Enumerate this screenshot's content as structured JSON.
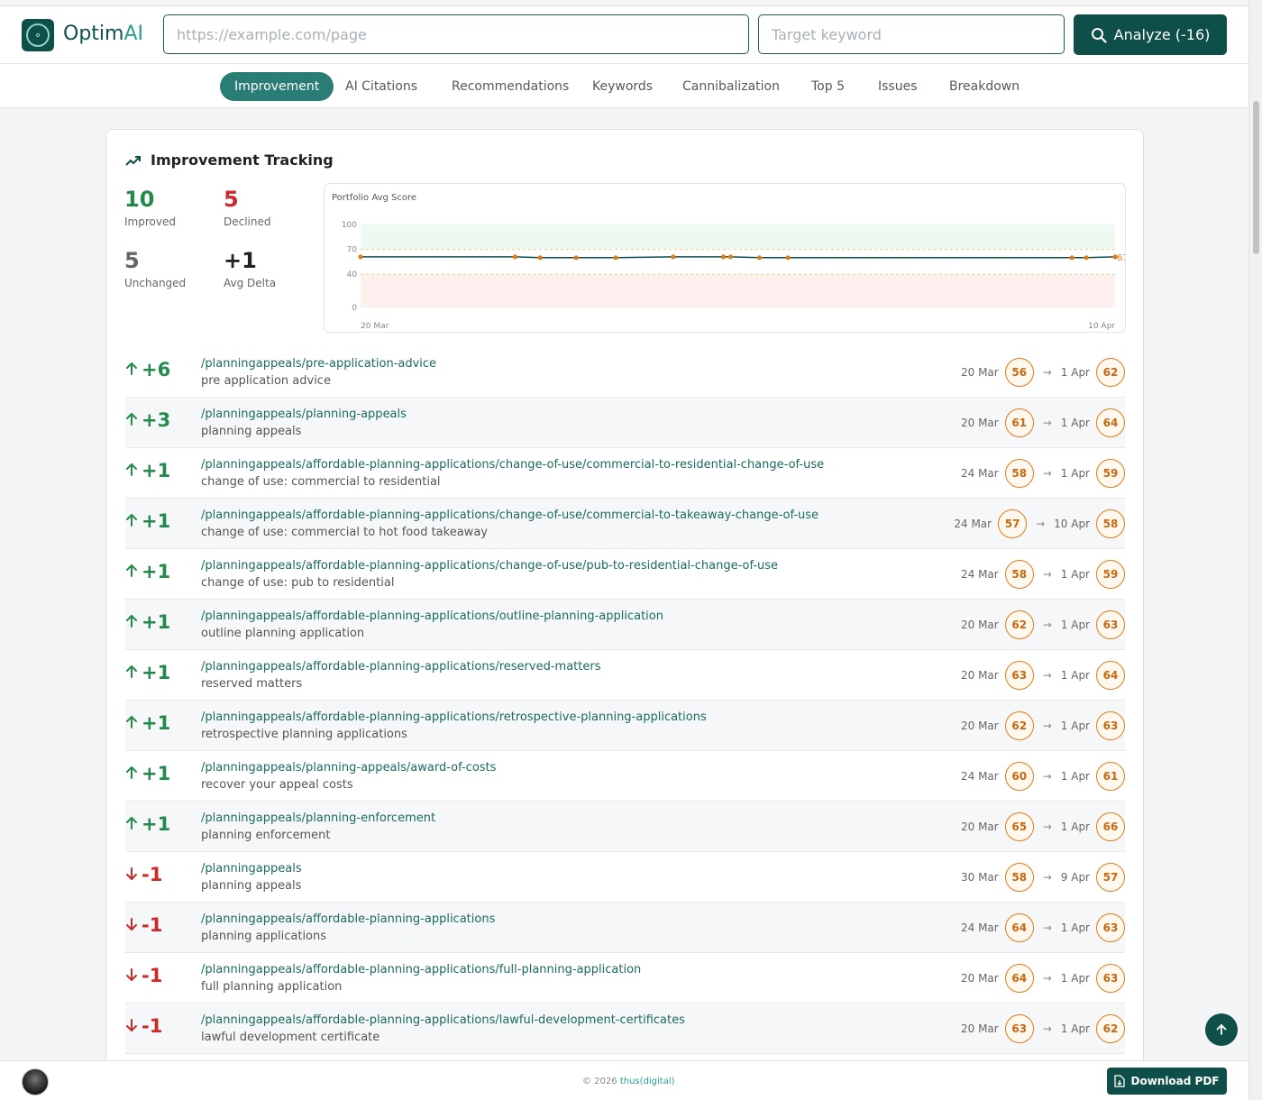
{
  "header": {
    "brand_prefix": "Optim",
    "brand_suffix": "AI",
    "url_placeholder": "https://example.com/page",
    "keyword_placeholder": "Target keyword",
    "analyze_label": "Analyze (-16)"
  },
  "tabs": [
    "Improvement",
    "AI Citations",
    "Recommendations",
    "Keywords",
    "Cannibalization",
    "Top 5",
    "Issues",
    "Breakdown"
  ],
  "active_tab": "Improvement",
  "card": {
    "title": "Improvement Tracking",
    "stats": {
      "improved": {
        "value": "10",
        "label": "Improved"
      },
      "declined": {
        "value": "5",
        "label": "Declined"
      },
      "unchanged": {
        "value": "5",
        "label": "Unchanged"
      },
      "avg_delta": {
        "value": "+1",
        "label": "Avg Delta"
      }
    }
  },
  "chart_data": {
    "type": "line",
    "title": "Portfolio Avg Score",
    "x_start_label": "20 Mar",
    "x_end_label": "10 Apr",
    "y_ticks": [
      "100",
      "70",
      "40",
      "0"
    ],
    "ylim": [
      0,
      100
    ],
    "bands": [
      {
        "from": 70,
        "to": 100,
        "color": "#eefaf1"
      },
      {
        "from": 40,
        "to": 70,
        "color": "#ffffff"
      },
      {
        "from": 0,
        "to": 40,
        "color": "#fdf0ef"
      }
    ],
    "thresholds": [
      70,
      40
    ],
    "x_range": [
      0,
      21
    ],
    "points": [
      {
        "x": 0,
        "y": 61
      },
      {
        "x": 4.3,
        "y": 61
      },
      {
        "x": 5,
        "y": 60
      },
      {
        "x": 6,
        "y": 60
      },
      {
        "x": 7.1,
        "y": 60
      },
      {
        "x": 8.7,
        "y": 61
      },
      {
        "x": 10.1,
        "y": 61
      },
      {
        "x": 10.3,
        "y": 61
      },
      {
        "x": 11.1,
        "y": 60
      },
      {
        "x": 11.9,
        "y": 60
      },
      {
        "x": 19.8,
        "y": 60
      },
      {
        "x": 20.2,
        "y": 60
      },
      {
        "x": 21,
        "y": 61
      }
    ],
    "last_label": "61",
    "line_color": "#0f4f4a",
    "point_color": "#e07b1a"
  },
  "rows": [
    {
      "delta": "+6",
      "dir": "up",
      "path": "/planningappeals/pre-application-advice",
      "keyword": "pre application advice",
      "from_date": "20 Mar",
      "from_score": "56",
      "to_date": "1 Apr",
      "to_score": "62"
    },
    {
      "delta": "+3",
      "dir": "up",
      "path": "/planningappeals/planning-appeals",
      "keyword": "planning appeals",
      "from_date": "20 Mar",
      "from_score": "61",
      "to_date": "1 Apr",
      "to_score": "64"
    },
    {
      "delta": "+1",
      "dir": "up",
      "path": "/planningappeals/affordable-planning-applications/change-of-use/commercial-to-residential-change-of-use",
      "keyword": "change of use: commercial to residential",
      "from_date": "24 Mar",
      "from_score": "58",
      "to_date": "1 Apr",
      "to_score": "59"
    },
    {
      "delta": "+1",
      "dir": "up",
      "path": "/planningappeals/affordable-planning-applications/change-of-use/commercial-to-takeaway-change-of-use",
      "keyword": "change of use: commercial to hot food takeaway",
      "from_date": "24 Mar",
      "from_score": "57",
      "to_date": "10 Apr",
      "to_score": "58"
    },
    {
      "delta": "+1",
      "dir": "up",
      "path": "/planningappeals/affordable-planning-applications/change-of-use/pub-to-residential-change-of-use",
      "keyword": "change of use: pub to residential",
      "from_date": "24 Mar",
      "from_score": "58",
      "to_date": "1 Apr",
      "to_score": "59"
    },
    {
      "delta": "+1",
      "dir": "up",
      "path": "/planningappeals/affordable-planning-applications/outline-planning-application",
      "keyword": "outline planning application",
      "from_date": "20 Mar",
      "from_score": "62",
      "to_date": "1 Apr",
      "to_score": "63"
    },
    {
      "delta": "+1",
      "dir": "up",
      "path": "/planningappeals/affordable-planning-applications/reserved-matters",
      "keyword": "reserved matters",
      "from_date": "20 Mar",
      "from_score": "63",
      "to_date": "1 Apr",
      "to_score": "64"
    },
    {
      "delta": "+1",
      "dir": "up",
      "path": "/planningappeals/affordable-planning-applications/retrospective-planning-applications",
      "keyword": "retrospective planning applications",
      "from_date": "20 Mar",
      "from_score": "62",
      "to_date": "1 Apr",
      "to_score": "63"
    },
    {
      "delta": "+1",
      "dir": "up",
      "path": "/planningappeals/planning-appeals/award-of-costs",
      "keyword": "recover your appeal costs",
      "from_date": "24 Mar",
      "from_score": "60",
      "to_date": "1 Apr",
      "to_score": "61"
    },
    {
      "delta": "+1",
      "dir": "up",
      "path": "/planningappeals/planning-enforcement",
      "keyword": "planning enforcement",
      "from_date": "20 Mar",
      "from_score": "65",
      "to_date": "1 Apr",
      "to_score": "66"
    },
    {
      "delta": "-1",
      "dir": "down",
      "path": "/planningappeals",
      "keyword": "planning appeals",
      "from_date": "30 Mar",
      "from_score": "58",
      "to_date": "9 Apr",
      "to_score": "57"
    },
    {
      "delta": "-1",
      "dir": "down",
      "path": "/planningappeals/affordable-planning-applications",
      "keyword": "planning applications",
      "from_date": "24 Mar",
      "from_score": "64",
      "to_date": "1 Apr",
      "to_score": "63"
    },
    {
      "delta": "-1",
      "dir": "down",
      "path": "/planningappeals/affordable-planning-applications/full-planning-application",
      "keyword": "full planning application",
      "from_date": "20 Mar",
      "from_score": "64",
      "to_date": "1 Apr",
      "to_score": "63"
    },
    {
      "delta": "-1",
      "dir": "down",
      "path": "/planningappeals/affordable-planning-applications/lawful-development-certificates",
      "keyword": "lawful development certificate",
      "from_date": "20 Mar",
      "from_score": "63",
      "to_date": "1 Apr",
      "to_score": "62"
    }
  ],
  "footer": {
    "copyright_prefix": "© 2026 ",
    "copyright_company": "thus(digital)",
    "pdf_label": "Download PDF"
  }
}
